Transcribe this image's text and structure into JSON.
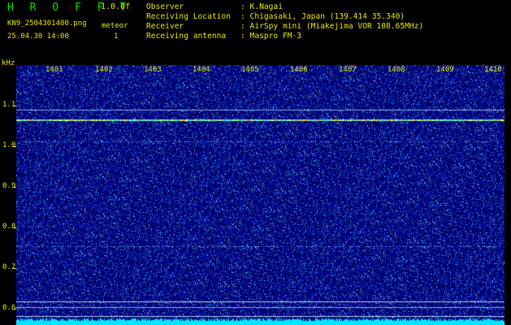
{
  "header": {
    "title": "H R O F F T",
    "version": "1.0.0f",
    "filename": "KN9_2504301400.png",
    "meteor_label": "meteor",
    "datetime": "25.04.30 14:00",
    "meteor_count": "1"
  },
  "meta": [
    {
      "key": "Observer",
      "value": ": K.Nagai"
    },
    {
      "key": "Receiving Location",
      "value": ": Chigasaki, Japan (139.414 35.340)"
    },
    {
      "key": "Receiver",
      "value": ": AirSpy mini (Miakejima VOR 108.65MHz)"
    },
    {
      "key": "Receiving antenna",
      "value": ": Maspro FM-3"
    }
  ],
  "axis": {
    "y_unit": "kHz",
    "y_ticks": [
      "1.1",
      "1.0",
      "0.9",
      "0.8",
      "0.7",
      "0.6"
    ],
    "x_ticks": [
      "1401",
      "1402",
      "1403",
      "1404",
      "1405",
      "1406",
      "1407",
      "1408",
      "1409",
      "1410"
    ]
  },
  "colors": {
    "label": "#e8e800",
    "title": "#00e000",
    "noise_floor": "#00e8ff"
  }
}
